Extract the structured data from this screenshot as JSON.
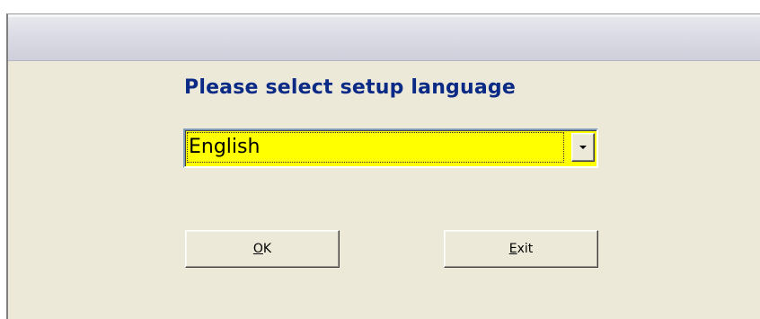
{
  "dialog": {
    "prompt": "Please select setup language",
    "language_select": {
      "selected_value": "English",
      "background_color": "#ffff00"
    },
    "buttons": {
      "ok_label": "OK",
      "exit_label": "Exit"
    },
    "prompt_color": "#0a2a86",
    "icons": {
      "dropdown": "chevron-down-icon"
    }
  }
}
